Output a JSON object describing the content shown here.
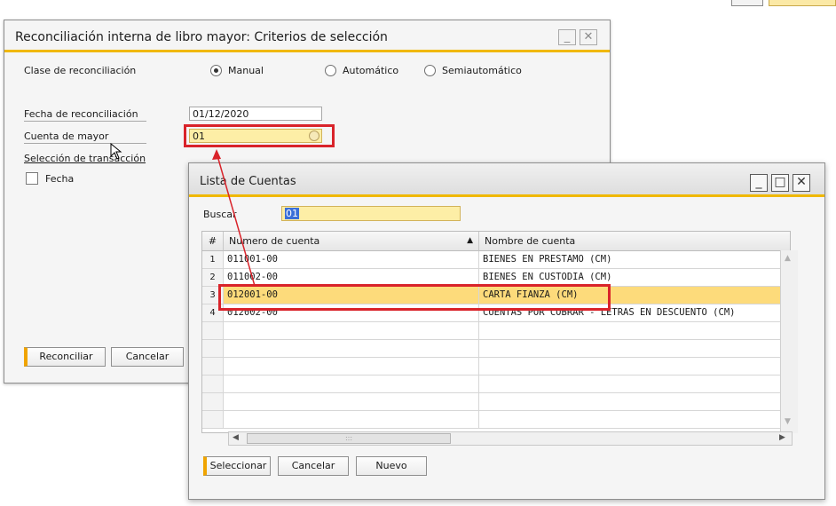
{
  "main_window": {
    "title": "Reconciliación interna de libro mayor: Criterios de selección",
    "reconciliation_class_label": "Clase de reconciliación",
    "radio_manual": "Manual",
    "radio_automatic": "Automático",
    "radio_semiautomatic": "Semiautomático",
    "date_label": "Fecha de reconciliación",
    "date_value": "01/12/2020",
    "account_label": "Cuenta de mayor",
    "account_value": "01",
    "transaction_selection_label": "Selección de transacción",
    "date_checkbox_label": "Fecha",
    "reconcile_button": "Reconciliar",
    "cancel_button": "Cancelar"
  },
  "dialog": {
    "title": "Lista de Cuentas",
    "search_label": "Buscar",
    "search_value": "01",
    "columns": [
      "#",
      "Numero de cuenta",
      "Nombre de cuenta"
    ],
    "rows": [
      {
        "n": "1",
        "code": "011001-00",
        "name": "BIENES EN PRESTAMO (CM)"
      },
      {
        "n": "2",
        "code": "011002-00",
        "name": "BIENES EN CUSTODIA (CM)"
      },
      {
        "n": "3",
        "code": "012001-00",
        "name": "CARTA FIANZA (CM)"
      },
      {
        "n": "4",
        "code": "012002-00",
        "name": "CUENTAS POR COBRAR - LETRAS EN DESCUENTO (CM)"
      }
    ],
    "selected_row": 3,
    "select_button": "Seleccionar",
    "cancel_button": "Cancelar",
    "new_button": "Nuevo",
    "scroll_thumb_glyph": ":::"
  },
  "colors": {
    "accent": "#f0b800",
    "selected_row": "#fddb7b",
    "highlight_field": "#fdeea6",
    "annotation_red": "#d9232a"
  },
  "icons": {
    "sort_icon": "triangle-up",
    "lookup_icon": "list-lookup",
    "minimize_icon": "minimize",
    "maximize_icon": "maximize",
    "close_icon": "close",
    "cursor_icon": "mouse-pointer"
  }
}
